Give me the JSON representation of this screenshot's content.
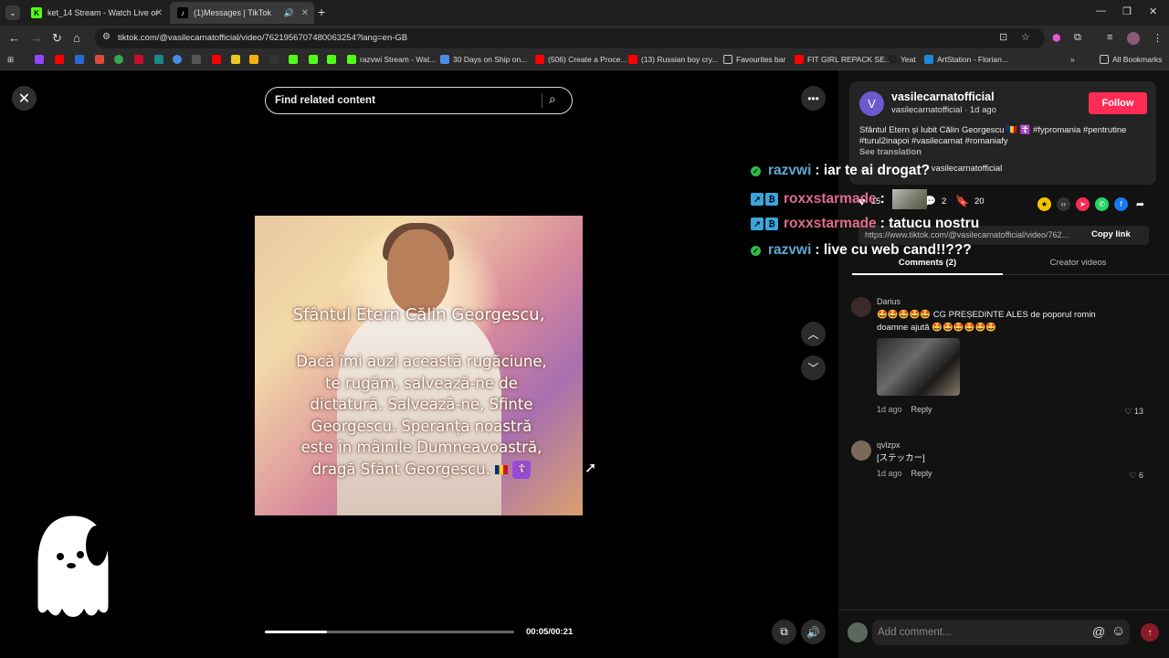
{
  "browser": {
    "tabs": [
      {
        "title": "ket_14 Stream - Watch Live on",
        "icon": "kick-icon"
      },
      {
        "title": "(1)Messages | TikTok",
        "icon": "tiktok-icon"
      }
    ],
    "new_tab": "+",
    "url": "tiktok.com/@vasilecarnatofficial/video/7621956707480063254?lang=en-GB",
    "bookmarks": [
      "razvwi Stream - Wat...",
      "30 Days on Ship on...",
      "(506) Create a Proce...",
      "(13) Russian boy cry...",
      "Favourites bar",
      "FIT GIRL REPACK SE...",
      "Yeat",
      "ArtStation - Florian..."
    ],
    "all_bookmarks": "All Bookmarks",
    "more_bookmarks": "»"
  },
  "video": {
    "search_placeholder": "Find related content",
    "title_line": "Sfântul Etern Călin Georgescu,",
    "body_lines": [
      "Dacă îmi auzi această rugăciune,",
      "te rugăm, salvează-ne de",
      "dictatură. Salvează-ne, Sfinte",
      "Georgescu. Speranța noastră",
      "este în mâinile Dumneavoastră,",
      "dragă Sfânt Georgescu."
    ],
    "cross_emoji": "☦",
    "time": "00:05/00:21",
    "progress": 0.25
  },
  "chat": [
    {
      "user": "razvwi",
      "message": ": iar te ai drogat?",
      "color": "#5fa8d3",
      "badge": "verified"
    },
    {
      "user": "roxxstarmade",
      "message": ":",
      "color": "#e06c8c",
      "badge": "sub"
    },
    {
      "user": "roxxstarmade",
      "message": ": tatucu nostru",
      "color": "#e06c8c",
      "badge": "sub"
    },
    {
      "user": "razvwi",
      "message": ": live cu web cand!!???",
      "color": "#5fa8d3",
      "badge": "verified"
    }
  ],
  "author": {
    "avatar_letter": "V",
    "name": "vasilecarnatofficial",
    "handle": "vasilecarnatofficial · 1d ago",
    "follow": "Follow",
    "caption": "Sfântul Etern și Iubit Călin Georgescu 🇷🇴 ☦️ #fypromania #pentrutine #turul2inapoi #vasilecarnat #romaniafy",
    "see_translation": "See translation",
    "music": "- vasilecarnatofficial"
  },
  "actions": {
    "likes": "15",
    "comments": "2",
    "saves": "20"
  },
  "link": {
    "url": "https://www.tiktok.com/@vasilecarnatofficial/video/762...",
    "copy": "Copy link"
  },
  "tabs": {
    "comments": "Comments (2)",
    "creator": "Creator videos"
  },
  "comments": [
    {
      "user": "Darius",
      "text": "🤩🤩🤩🤩🤩 CG PREȘEDINTE ALES de poporul romin doamne ajută 🤩🤩🤩🤩🤩🤩",
      "time": "1d ago",
      "reply": "Reply",
      "likes": "13"
    },
    {
      "user": "qvlzpx",
      "text": "[ステッカー]",
      "time": "1d ago",
      "reply": "Reply",
      "likes": "6"
    }
  ],
  "comment_bar": {
    "placeholder": "Add comment...",
    "at": "@"
  },
  "colors": {
    "follow": "#fe2c55",
    "panel": "#121212",
    "verified": "#2ebd4a"
  }
}
